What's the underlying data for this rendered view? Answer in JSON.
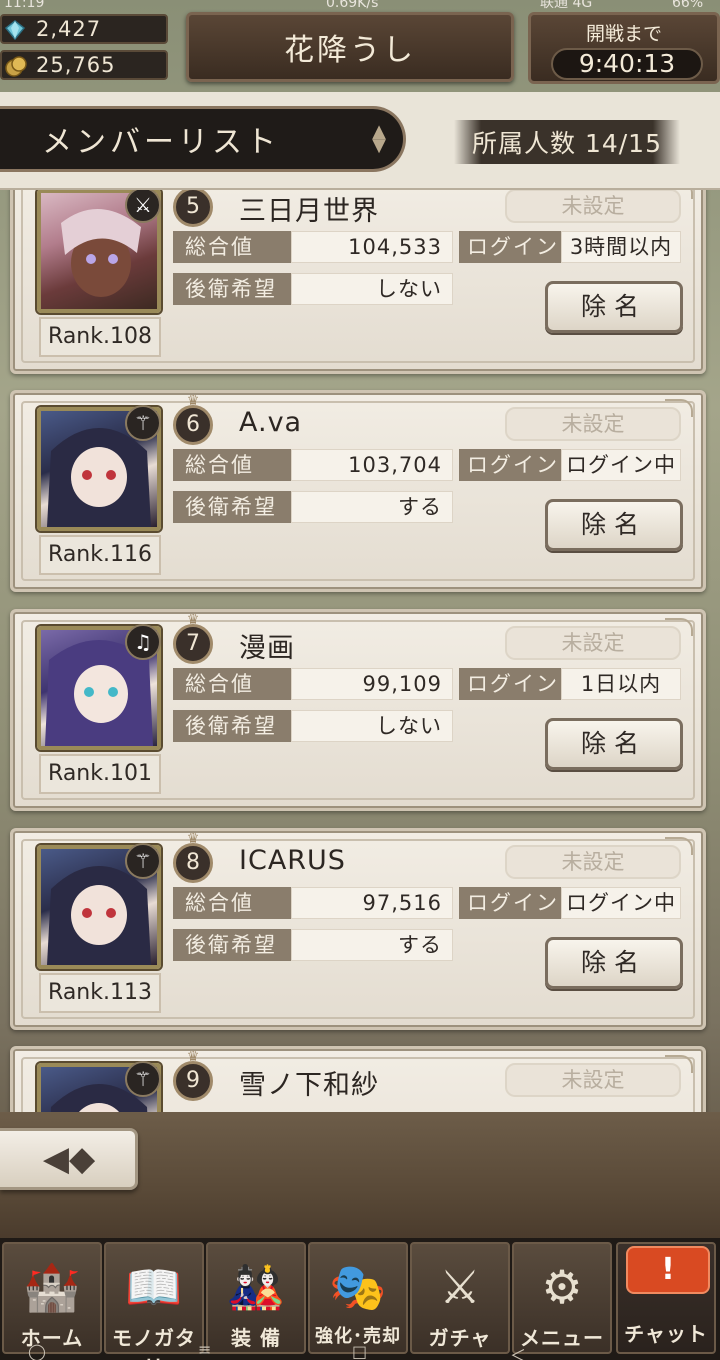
{
  "status_bar": {
    "time": "11:19",
    "network_speed": "0.69K/s",
    "carrier": "联通 4G",
    "battery": "66%"
  },
  "currency": {
    "gems": "2,427",
    "coins": "25,765"
  },
  "header": {
    "guild_name": "花降うし",
    "timer_label": "開戦まで",
    "timer_value": "9:40:13"
  },
  "list_header": {
    "title": "メンバーリスト",
    "member_count": "所属人数 14/15"
  },
  "labels": {
    "total_power": "総合値",
    "login": "ログイン",
    "rearguard": "後衛希望",
    "kick": "除名"
  },
  "members": [
    {
      "number": "5",
      "name": "三日月世界",
      "role": "未設定",
      "rank": "Rank.108",
      "total": "104,533",
      "login": "3時間以内",
      "rearguard": "しない",
      "weapon_icon": "sword-icon"
    },
    {
      "number": "6",
      "name": "A.va",
      "role": "未設定",
      "rank": "Rank.116",
      "total": "103,704",
      "login": "ログイン中",
      "rearguard": "する",
      "weapon_icon": "staff-icon"
    },
    {
      "number": "7",
      "name": "漫画",
      "role": "未設定",
      "rank": "Rank.101",
      "total": "99,109",
      "login": "1日以内",
      "rearguard": "しない",
      "weapon_icon": "harp-icon"
    },
    {
      "number": "8",
      "name": "ICARUS",
      "role": "未設定",
      "rank": "Rank.113",
      "total": "97,516",
      "login": "ログイン中",
      "rearguard": "する",
      "weapon_icon": "staff-icon"
    },
    {
      "number": "9",
      "name": "雪ノ下和紗",
      "role": "未設定",
      "rank": "",
      "total": "",
      "login": "",
      "rearguard": "",
      "weapon_icon": "staff-icon"
    }
  ],
  "nav": [
    {
      "label": "ホーム",
      "icon": "castle-icon"
    },
    {
      "label": "モノガタリ",
      "icon": "book-icon"
    },
    {
      "label": "装 備",
      "icon": "puppet-icon"
    },
    {
      "label": "強化･売却",
      "icon": "mask-icon"
    },
    {
      "label": "ガチャ",
      "icon": "crossed-weapons-icon"
    },
    {
      "label": "メニュー",
      "icon": "gears-icon"
    },
    {
      "label": "チャット",
      "icon": "chat-alert-icon"
    }
  ],
  "chat_alert": "!",
  "colors": {
    "accent_dark": "#3a2c21",
    "card_bg": "#f2ede4",
    "label_bg": "#8a7d6c",
    "chat_alert": "#d94a22"
  }
}
